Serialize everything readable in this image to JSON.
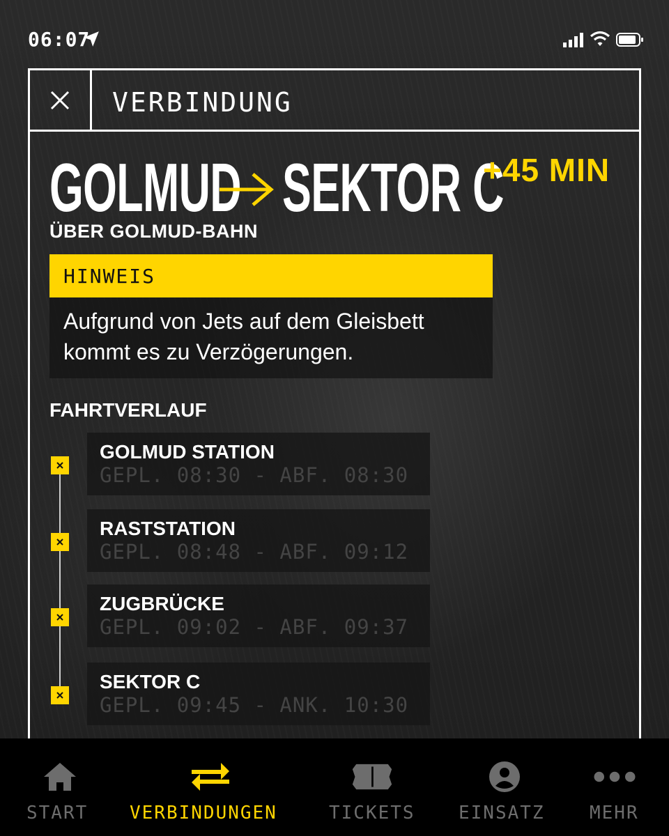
{
  "status": {
    "time": "06:07"
  },
  "header": {
    "title": "VERBINDUNG"
  },
  "route": {
    "from": "GOLMUD",
    "to": "SEKTOR C",
    "delay": "+45 MIN",
    "via": "ÜBER GOLMUD-BAHN"
  },
  "notice": {
    "title": "HINWEIS",
    "line1": "Aufgrund von Jets auf dem Gleisbett",
    "line2": "kommt es zu Verzögerungen."
  },
  "itinerary": {
    "label": "FAHRTVERLAUF",
    "stops": [
      {
        "name": "GOLMUD STATION",
        "times": "GEPL. 08:30 - ABF. 08:30"
      },
      {
        "name": "RASTSTATION",
        "times": "GEPL. 08:48 - ABF. 09:12"
      },
      {
        "name": "ZUGBRÜCKE",
        "times": "GEPL. 09:02 - ABF. 09:37"
      },
      {
        "name": "SEKTOR C",
        "times": "GEPL. 09:45 - ANK. 10:30"
      }
    ]
  },
  "tabs": [
    {
      "label": "START",
      "icon": "home-icon"
    },
    {
      "label": "VERBINDUNGEN",
      "icon": "swap-arrows-icon",
      "active": true
    },
    {
      "label": "TICKETS",
      "icon": "ticket-icon"
    },
    {
      "label": "EINSATZ",
      "icon": "profile-icon"
    },
    {
      "label": "MEHR",
      "icon": "more-dots-icon"
    }
  ],
  "colors": {
    "accent": "#ffd500",
    "background": "#262626",
    "tabbar": "#000000",
    "inactive": "#6d6d6d"
  }
}
